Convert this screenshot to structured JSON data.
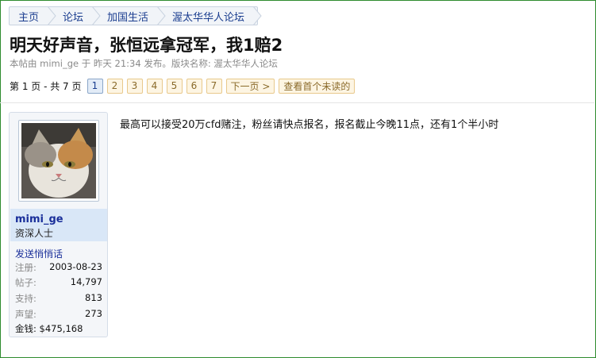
{
  "breadcrumb": [
    {
      "label": "主页"
    },
    {
      "label": "论坛"
    },
    {
      "label": "加国生活"
    },
    {
      "label": "渥太华华人论坛"
    }
  ],
  "thread": {
    "title": "明天好声音，张恒远拿冠军，我1赔2",
    "meta": "本帖由 mimi_ge 于 昨天 21:34 发布。版块名称: 渥太华华人论坛"
  },
  "pagination": {
    "info": "第 1 页 - 共 7 页",
    "pages": [
      "1",
      "2",
      "3",
      "4",
      "5",
      "6",
      "7"
    ],
    "current": "1",
    "next_label": "下一页 >",
    "first_unread_label": "查看首个未读的"
  },
  "user": {
    "avatar_icon": "cat-avatar",
    "name": "mimi_ge",
    "title": "资深人士",
    "pm_label": "发送悄悄话",
    "stats": [
      {
        "key": "注册:",
        "value": "2003-08-23"
      },
      {
        "key": "帖子:",
        "value": "14,797"
      },
      {
        "key": "支持:",
        "value": "813"
      },
      {
        "key": "声望:",
        "value": "273"
      }
    ],
    "money": "金钱: $475,168"
  },
  "post": {
    "text": "最高可以接受20万cfd赌注，粉丝请快点报名，报名截止今晚11点，还有1个半小时"
  },
  "colors": {
    "frame": "#2e8b2e",
    "link": "#1a3d8f",
    "page_button_bg": "#fdf5e3",
    "user_head_bg": "#d9e7f7"
  }
}
